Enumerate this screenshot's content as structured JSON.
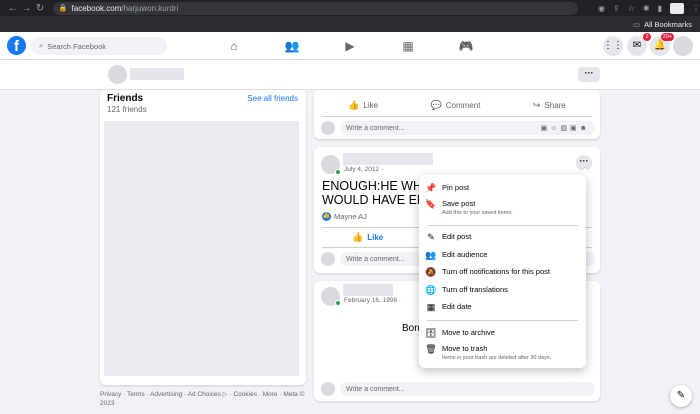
{
  "browser": {
    "url_host": "facebook.com",
    "url_path": "/harjuwon.kurdri",
    "bookmarks_label": "All Bookmarks"
  },
  "nav": {
    "search_placeholder": "Search Facebook",
    "messenger_badge": "2",
    "notifications_badge": "20+"
  },
  "friends": {
    "title": "Friends",
    "count": "121 friends",
    "see_all": "See all friends"
  },
  "footer": {
    "text": "Privacy · Terms · Advertising · Ad Choices ▷ · Cookies · More · Meta © 2023"
  },
  "posts": {
    "like": "Like",
    "comment": "Comment",
    "share": "Share",
    "comment_placeholder": "Write a comment...",
    "post2": {
      "date": "July 4, 2012 ·",
      "text_line1": "ENOUGH:HE WHO",
      "text_line2": "WOULD HAVE ENO",
      "liker": "Mayne AJ"
    },
    "post3": {
      "date": "February 16, 1998 ·",
      "text": "Born"
    }
  },
  "menu": {
    "pin": "Pin post",
    "save": "Save post",
    "save_sub": "Add this to your saved items.",
    "edit_post": "Edit post",
    "edit_audience": "Edit audience",
    "turn_off_notifs": "Turn off notifications for this post",
    "turn_off_translations": "Turn off translations",
    "edit_date": "Edit date",
    "archive": "Move to archive",
    "trash": "Move to trash",
    "trash_sub": "Items in your trash are deleted after 30 days."
  }
}
